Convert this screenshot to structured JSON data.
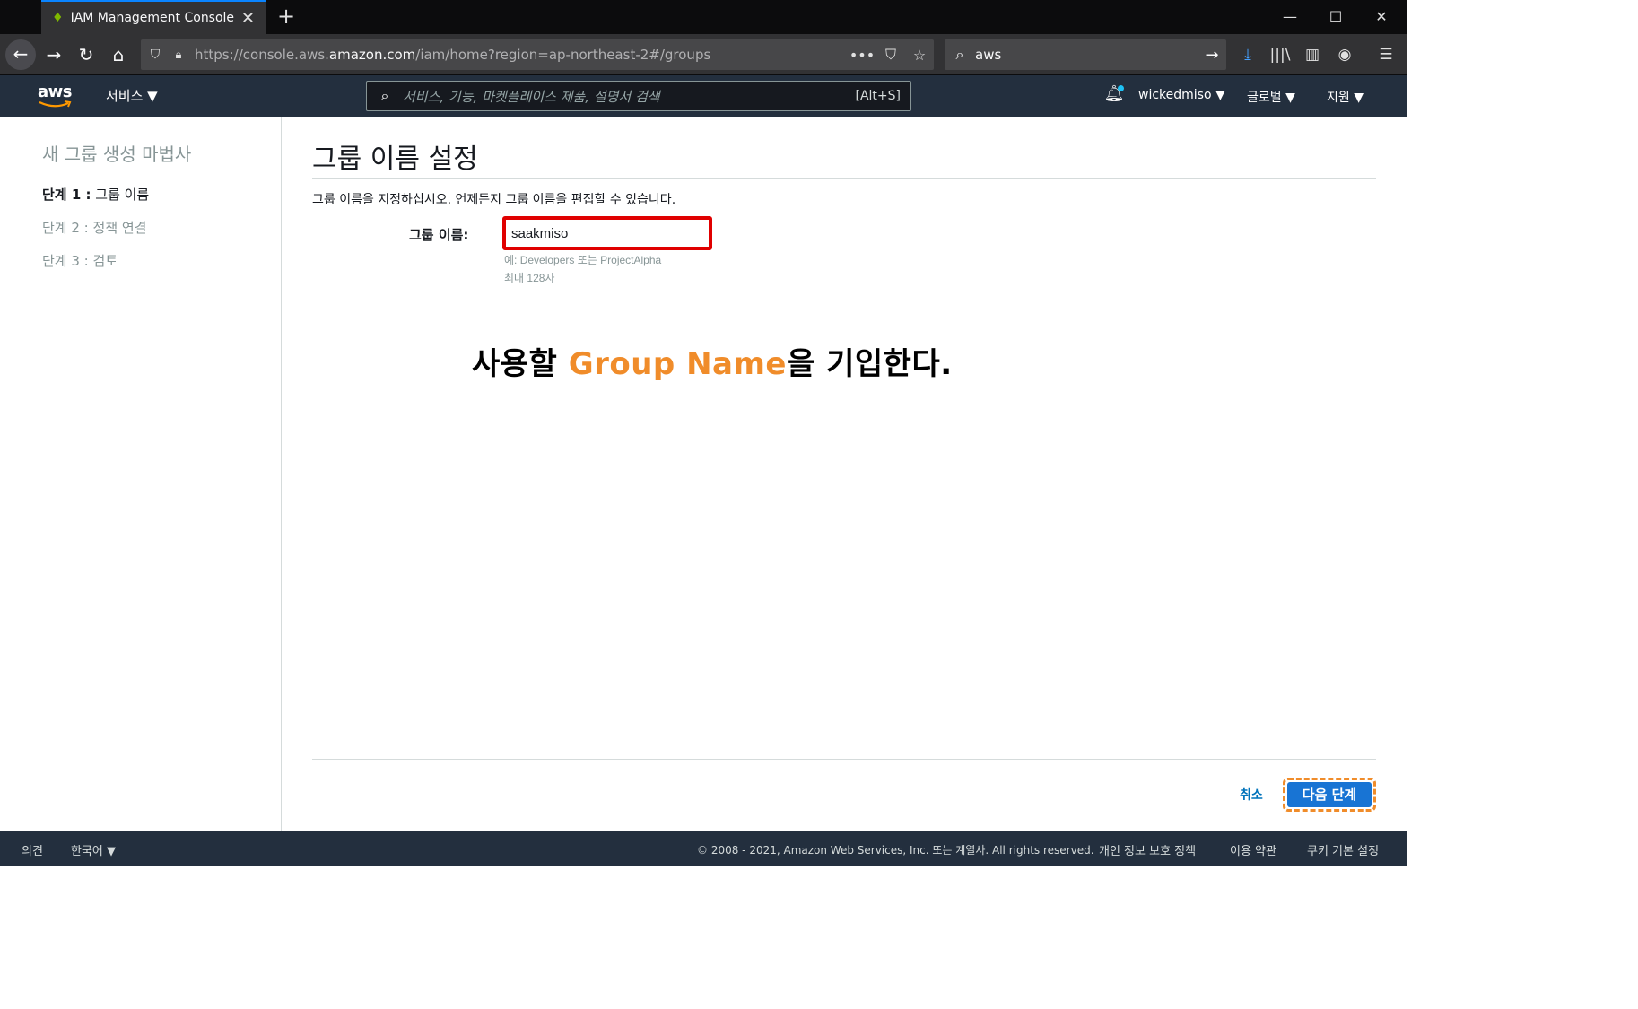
{
  "browser": {
    "tab_title": "IAM Management Console",
    "url_prefix": "https://console.aws.",
    "url_domain": "amazon.com",
    "url_path": "/iam/home?region=ap-northeast-2#/groups",
    "search_value": "aws"
  },
  "aws_header": {
    "logo": "aws",
    "services": "서비스 ▼",
    "search_placeholder": "서비스, 기능, 마켓플레이스 제품, 설명서 검색",
    "search_shortcut": "[Alt+S]",
    "account": "wickedmiso ▼",
    "region": "글로벌 ▼",
    "support": "지원 ▼"
  },
  "sidebar": {
    "title": "새 그룹 생성 마법사",
    "steps": [
      {
        "prefix": "단계 1 :",
        "label": "그룹 이름"
      },
      {
        "prefix": "단계 2 :",
        "label": "정책 연결"
      },
      {
        "prefix": "단계 3 :",
        "label": "검토"
      }
    ]
  },
  "main": {
    "title": "그룹 이름 설정",
    "description": "그룹 이름을 지정하십시오. 언제든지 그룹 이름을 편집할 수 있습니다.",
    "field_label": "그룹 이름:",
    "field_value": "saakmiso",
    "hint_example": "예: Developers 또는 ProjectAlpha",
    "hint_max": "최대 128자",
    "annotation_pre": "사용할 ",
    "annotation_accent": "Group Name",
    "annotation_post": "을 기입한다.",
    "cancel": "취소",
    "next": "다음 단계"
  },
  "footer": {
    "feedback": "의견",
    "language": "한국어 ▼",
    "copyright": "© 2008 - 2021, Amazon Web Services, Inc. 또는 계열사. All rights reserved.",
    "privacy": "개인 정보 보호 정책",
    "terms": "이용 약관",
    "cookies": "쿠키 기본 설정"
  },
  "colors": {
    "aws_nav": "#232f3e",
    "highlight_red": "#e00000",
    "annotation_orange": "#f08c2a",
    "primary_button": "#1874d4"
  }
}
